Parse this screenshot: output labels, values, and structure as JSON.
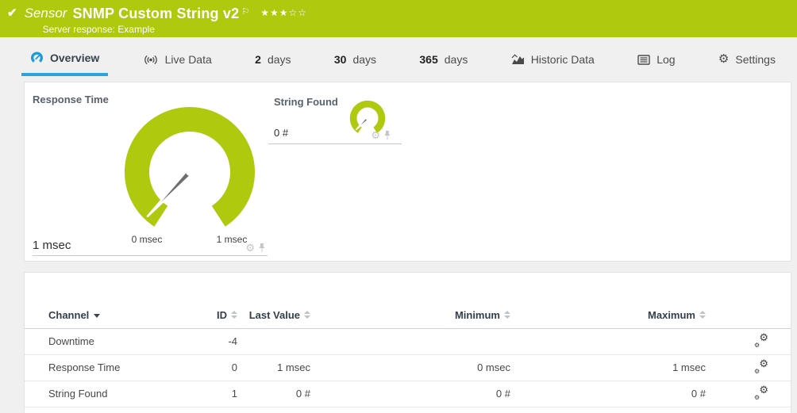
{
  "colors": {
    "brand_green": "#aec90e",
    "active_tab_blue": "#2ca3dc",
    "needle_gray": "#6e6e6e"
  },
  "icons": {
    "check": "✔",
    "flag": "⚐",
    "gear": "⚙"
  },
  "header": {
    "kind_label": "Sensor",
    "title": "SNMP Custom String v2",
    "subtitle": "Server response: Example",
    "rating_filled": "★★★",
    "rating_empty": "☆☆"
  },
  "tabs": [
    {
      "label": "Overview",
      "active": true
    },
    {
      "label": "Live Data"
    },
    {
      "strong": "2",
      "label": "days"
    },
    {
      "strong": "30",
      "label": "days"
    },
    {
      "strong": "365",
      "label": "days"
    },
    {
      "label": "Historic Data"
    },
    {
      "label": "Log"
    },
    {
      "label": "Settings"
    }
  ],
  "gauges": {
    "response_time": {
      "title": "Response Time",
      "current_value": "1 msec",
      "scale_min_label": "0 msec",
      "scale_max_label": "1 msec",
      "color": "#aec90e"
    },
    "string_found": {
      "title": "String Found",
      "current_value": "0 #",
      "color": "#aec90e"
    }
  },
  "table": {
    "sorted_by": "Channel",
    "columns": {
      "channel": "Channel",
      "id": "ID",
      "last_value": "Last Value",
      "minimum": "Minimum",
      "maximum": "Maximum"
    },
    "rows": [
      {
        "channel": "Downtime",
        "id": "-4",
        "last_value": "",
        "minimum": "",
        "maximum": ""
      },
      {
        "channel": "Response Time",
        "id": "0",
        "last_value": "1 msec",
        "minimum": "0 msec",
        "maximum": "1 msec"
      },
      {
        "channel": "String Found",
        "id": "1",
        "last_value": "0 #",
        "minimum": "0 #",
        "maximum": "0 #"
      }
    ]
  }
}
